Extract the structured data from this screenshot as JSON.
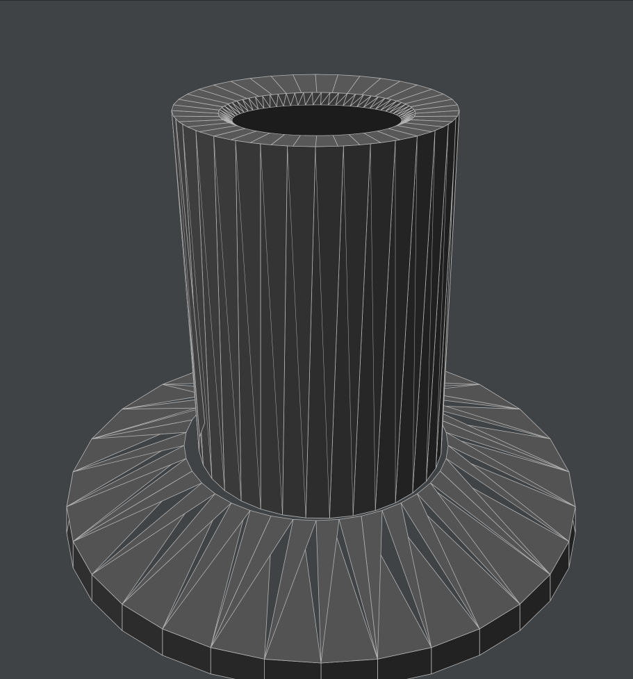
{
  "viewport": {
    "background_color": "#3f4346",
    "wire_color": "#b4b4b4"
  },
  "model": {
    "shape": "flanged-cylinder",
    "render_mode": "shaded-wireframe",
    "base_color": "#525252",
    "side_dark_color": "#222222"
  }
}
